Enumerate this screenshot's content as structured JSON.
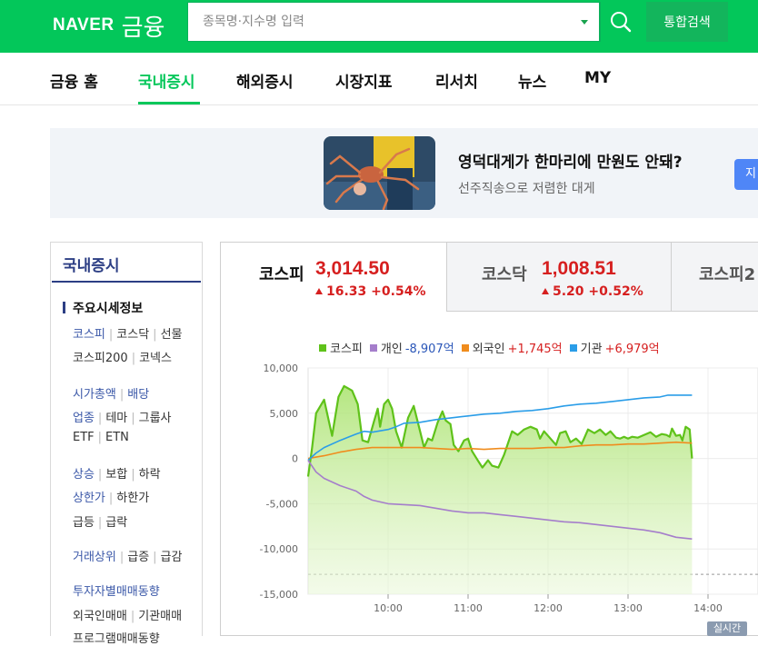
{
  "header": {
    "logo_brand": "NAVER",
    "logo_service": "금융",
    "search_placeholder": "종목명·지수명 입력",
    "unified_search_label": "통합검색"
  },
  "nav": {
    "tabs": [
      {
        "label": "금융 홈"
      },
      {
        "label": "국내증시",
        "active": true
      },
      {
        "label": "해외증시"
      },
      {
        "label": "시장지표"
      },
      {
        "label": "리서치"
      },
      {
        "label": "뉴스"
      },
      {
        "label": "MY"
      }
    ]
  },
  "banner": {
    "title": "영덕대게가 한마리에 만원도 안돼?",
    "subtitle": "선주직송으로 저렴한 대게",
    "button_partial": "지"
  },
  "sidebar": {
    "title": "국내증시",
    "section": "주요시세정보",
    "rows": [
      [
        "코스피",
        "코스닥",
        "선물"
      ],
      [
        "코스피200",
        "코넥스"
      ],
      [
        "시가총액",
        "배당"
      ],
      [
        "업종",
        "테마",
        "그룹사"
      ],
      [
        "ETF",
        "ETN"
      ],
      [
        "상승",
        "보합",
        "하락"
      ],
      [
        "상한가",
        "하한가"
      ],
      [
        "급등",
        "급락"
      ],
      [
        "거래상위",
        "급증",
        "급감"
      ],
      [
        "투자자별매매동향"
      ],
      [
        "외국인매매",
        "기관매매"
      ],
      [
        "프로그램매매동향"
      ]
    ]
  },
  "indices": [
    {
      "name": "코스피",
      "value": "3,014.50",
      "change": "16.33",
      "rate": "+0.54%"
    },
    {
      "name": "코스닥",
      "value": "1,008.51",
      "change": "5.20",
      "rate": "+0.52%"
    },
    {
      "name": "코스피2",
      "value": "",
      "change": "",
      "rate": ""
    }
  ],
  "legend": [
    {
      "name": "코스피",
      "value": "",
      "color": "#5fc21a"
    },
    {
      "name": "개인",
      "value": "-8,907억",
      "color": "#a57ecb",
      "value_color": "#2a56b8"
    },
    {
      "name": "외국인",
      "value": "+1,745억",
      "color": "#f08c1d",
      "value_color": "#d61f1f"
    },
    {
      "name": "기관",
      "value": "+6,979억",
      "color": "#2a9de8",
      "value_color": "#d61f1f"
    }
  ],
  "realtime_label": "실시간",
  "colors": {
    "brand": "#03c75a",
    "up": "#d61f1f",
    "down": "#2a56b8",
    "navy": "#2c3e84"
  },
  "chart_data": {
    "type": "line",
    "y_ticks": [
      "10,000",
      "5,000",
      "0",
      "-5,000",
      "-10,000",
      "-15,000"
    ],
    "x_ticks": [
      "10:00",
      "11:00",
      "12:00",
      "13:00",
      "14:00"
    ],
    "ylim": [
      -15000,
      10000
    ],
    "x_range": [
      "09:00",
      "14:00"
    ],
    "baseline": -12800,
    "series": [
      {
        "name": "코스피",
        "type": "area",
        "color": "#5fc21a",
        "points": [
          [
            0,
            -2000
          ],
          [
            0.05,
            1200
          ],
          [
            0.1,
            5000
          ],
          [
            0.2,
            6500
          ],
          [
            0.3,
            2500
          ],
          [
            0.38,
            6800
          ],
          [
            0.45,
            8000
          ],
          [
            0.55,
            7500
          ],
          [
            0.62,
            6000
          ],
          [
            0.68,
            2000
          ],
          [
            0.75,
            1800
          ],
          [
            0.82,
            4000
          ],
          [
            0.87,
            5500
          ],
          [
            0.9,
            3500
          ],
          [
            0.95,
            6000
          ],
          [
            1.0,
            6500
          ],
          [
            1.05,
            5500
          ],
          [
            1.1,
            3000
          ],
          [
            1.17,
            1200
          ],
          [
            1.25,
            4500
          ],
          [
            1.32,
            5800
          ],
          [
            1.4,
            3000
          ],
          [
            1.45,
            1200
          ],
          [
            1.5,
            2200
          ],
          [
            1.55,
            2000
          ],
          [
            1.62,
            4000
          ],
          [
            1.68,
            5200
          ],
          [
            1.72,
            4200
          ],
          [
            1.78,
            3800
          ],
          [
            1.82,
            1500
          ],
          [
            1.88,
            800
          ],
          [
            1.95,
            2000
          ],
          [
            2.0,
            2200
          ],
          [
            2.05,
            800
          ],
          [
            2.12,
            -200
          ],
          [
            2.18,
            -1000
          ],
          [
            2.25,
            -200
          ],
          [
            2.3,
            -800
          ],
          [
            2.38,
            -1000
          ],
          [
            2.45,
            400
          ],
          [
            2.55,
            3000
          ],
          [
            2.62,
            2600
          ],
          [
            2.7,
            3200
          ],
          [
            2.78,
            3500
          ],
          [
            2.86,
            3200
          ],
          [
            2.9,
            2200
          ],
          [
            2.95,
            3000
          ],
          [
            3.05,
            2000
          ],
          [
            3.1,
            1500
          ],
          [
            3.15,
            2800
          ],
          [
            3.22,
            3000
          ],
          [
            3.28,
            1800
          ],
          [
            3.35,
            2200
          ],
          [
            3.42,
            1600
          ],
          [
            3.5,
            3200
          ],
          [
            3.58,
            2800
          ],
          [
            3.65,
            3200
          ],
          [
            3.72,
            2600
          ],
          [
            3.78,
            3000
          ],
          [
            3.85,
            2300
          ],
          [
            3.9,
            2200
          ],
          [
            3.95,
            2400
          ],
          [
            4.0,
            2200
          ],
          [
            4.05,
            2400
          ],
          [
            4.12,
            2300
          ],
          [
            4.2,
            2600
          ],
          [
            4.28,
            2900
          ],
          [
            4.35,
            2400
          ],
          [
            4.42,
            2700
          ],
          [
            4.48,
            2600
          ],
          [
            4.52,
            2400
          ],
          [
            4.55,
            3300
          ],
          [
            4.6,
            2500
          ],
          [
            4.65,
            2600
          ],
          [
            4.68,
            2000
          ],
          [
            4.72,
            3500
          ],
          [
            4.77,
            3200
          ],
          [
            4.8,
            0
          ]
        ]
      },
      {
        "name": "외국인",
        "type": "line",
        "color": "#f08c1d",
        "points": [
          [
            0,
            0
          ],
          [
            0.2,
            300
          ],
          [
            0.4,
            700
          ],
          [
            0.6,
            1000
          ],
          [
            0.8,
            1200
          ],
          [
            1.0,
            1200
          ],
          [
            1.2,
            1200
          ],
          [
            1.4,
            1200
          ],
          [
            1.6,
            1100
          ],
          [
            1.8,
            1000
          ],
          [
            2.0,
            1100
          ],
          [
            2.2,
            1000
          ],
          [
            2.4,
            1100
          ],
          [
            2.6,
            1100
          ],
          [
            2.8,
            1100
          ],
          [
            3.0,
            1200
          ],
          [
            3.2,
            1200
          ],
          [
            3.4,
            1400
          ],
          [
            3.6,
            1500
          ],
          [
            3.8,
            1500
          ],
          [
            4.0,
            1600
          ],
          [
            4.2,
            1600
          ],
          [
            4.4,
            1700
          ],
          [
            4.6,
            1800
          ],
          [
            4.8,
            1700
          ]
        ]
      },
      {
        "name": "기관",
        "type": "line",
        "color": "#2a9de8",
        "points": [
          [
            0,
            -200
          ],
          [
            0.1,
            600
          ],
          [
            0.2,
            1200
          ],
          [
            0.4,
            2000
          ],
          [
            0.6,
            2700
          ],
          [
            0.7,
            3000
          ],
          [
            0.8,
            2900
          ],
          [
            1.0,
            3200
          ],
          [
            1.1,
            3500
          ],
          [
            1.2,
            3900
          ],
          [
            1.4,
            4000
          ],
          [
            1.6,
            4300
          ],
          [
            1.8,
            4500
          ],
          [
            2.0,
            4700
          ],
          [
            2.2,
            4900
          ],
          [
            2.4,
            5000
          ],
          [
            2.6,
            5200
          ],
          [
            2.8,
            5300
          ],
          [
            3.0,
            5500
          ],
          [
            3.2,
            5800
          ],
          [
            3.4,
            6000
          ],
          [
            3.6,
            6100
          ],
          [
            3.8,
            6300
          ],
          [
            4.0,
            6500
          ],
          [
            4.2,
            6700
          ],
          [
            4.4,
            6800
          ],
          [
            4.5,
            7000
          ],
          [
            4.6,
            7000
          ],
          [
            4.8,
            7000
          ]
        ]
      },
      {
        "name": "개인",
        "type": "line",
        "color": "#a57ecb",
        "points": [
          [
            0,
            -200
          ],
          [
            0.1,
            -1500
          ],
          [
            0.2,
            -2200
          ],
          [
            0.4,
            -3000
          ],
          [
            0.6,
            -3600
          ],
          [
            0.7,
            -4200
          ],
          [
            0.8,
            -4600
          ],
          [
            1.0,
            -5000
          ],
          [
            1.2,
            -5100
          ],
          [
            1.4,
            -5200
          ],
          [
            1.6,
            -5500
          ],
          [
            1.8,
            -5800
          ],
          [
            2.0,
            -6000
          ],
          [
            2.2,
            -6000
          ],
          [
            2.4,
            -6200
          ],
          [
            2.6,
            -6400
          ],
          [
            2.8,
            -6600
          ],
          [
            3.0,
            -6800
          ],
          [
            3.2,
            -7000
          ],
          [
            3.4,
            -7100
          ],
          [
            3.6,
            -7300
          ],
          [
            3.8,
            -7500
          ],
          [
            4.0,
            -7700
          ],
          [
            4.2,
            -7900
          ],
          [
            4.4,
            -8200
          ],
          [
            4.6,
            -8700
          ],
          [
            4.8,
            -8900
          ]
        ]
      }
    ]
  }
}
